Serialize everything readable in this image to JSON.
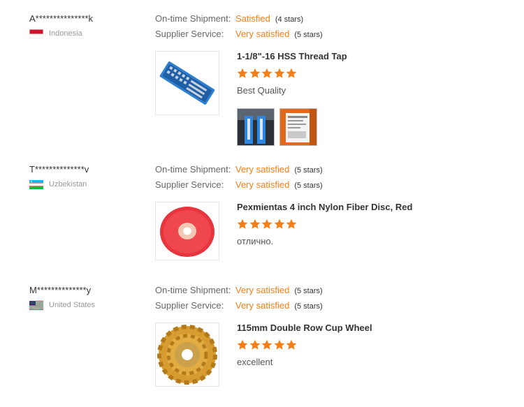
{
  "labels": {
    "shipment": "On-time Shipment:",
    "service": "Supplier Service:"
  },
  "colors": {
    "accent": "#f57f17",
    "star": "#f57f17"
  },
  "reviews": [
    {
      "buyer": "A***************k",
      "country": "Indonesia",
      "flag": "indonesia-flag",
      "shipment": {
        "value": "Satisfied",
        "stars": "(4 stars)"
      },
      "service": {
        "value": "Very satisfied",
        "stars": "(5 stars)"
      },
      "product": {
        "title": "1-1/8\"-16 HSS Thread Tap",
        "image": "thread-tap-set-image"
      },
      "rating": 5,
      "feedback": "Best Quality",
      "photos": [
        "review-photo-tap-icon",
        "review-photo-package-icon"
      ]
    },
    {
      "buyer": "T**************v",
      "country": "Uzbekistan",
      "flag": "uzbekistan-flag",
      "shipment": {
        "value": "Very satisfied",
        "stars": "(5 stars)"
      },
      "service": {
        "value": "Very satisfied",
        "stars": "(5 stars)"
      },
      "product": {
        "title": "Pexmientas 4 inch Nylon Fiber Disc, Red",
        "image": "nylon-fiber-disc-image"
      },
      "rating": 5,
      "feedback": "отлично.",
      "photos": []
    },
    {
      "buyer": "M**************y",
      "country": "United States",
      "flag": "united-states-flag",
      "shipment": {
        "value": "Very satisfied",
        "stars": "(5 stars)"
      },
      "service": {
        "value": "Very satisfied",
        "stars": "(5 stars)"
      },
      "product": {
        "title": "115mm Double Row Cup Wheel",
        "image": "cup-wheel-image"
      },
      "rating": 5,
      "feedback": "excellent",
      "photos": []
    }
  ]
}
